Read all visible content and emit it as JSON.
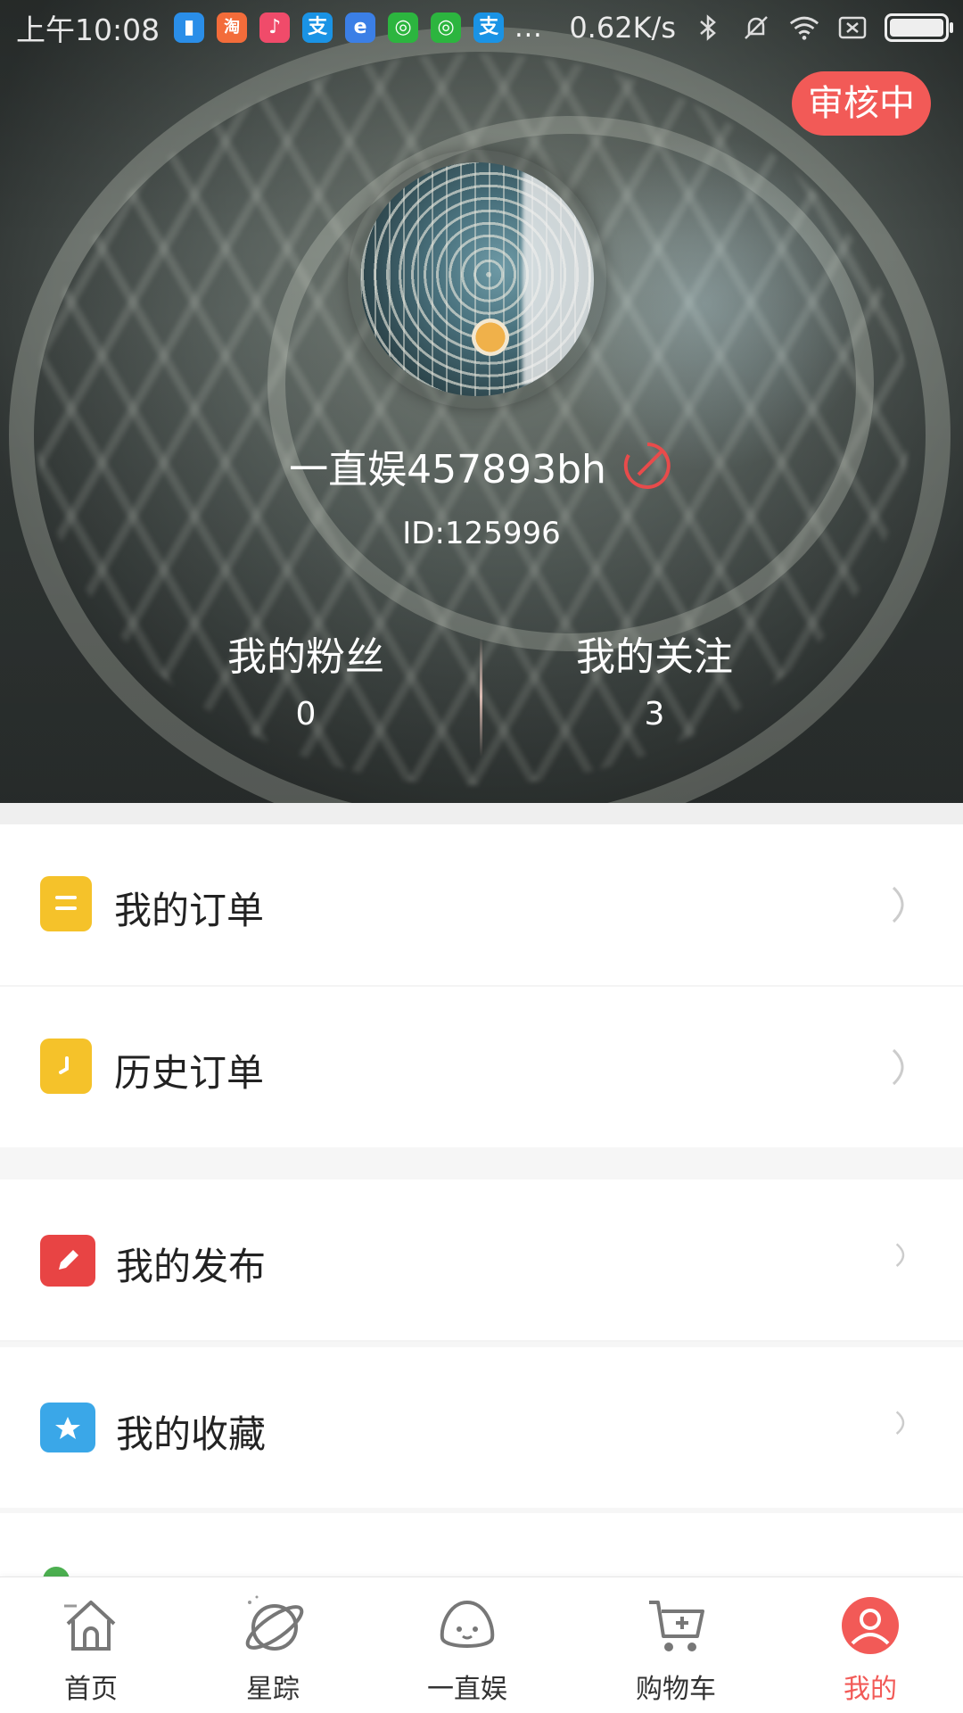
{
  "status_bar": {
    "time": "上午10:08",
    "apps": [
      {
        "icon": "notes-app-icon",
        "glyph": "▮",
        "color": "#2a8ee8"
      },
      {
        "icon": "taobao-app-icon",
        "glyph": "淘",
        "color": "#f36c3a"
      },
      {
        "icon": "douyin-app-icon",
        "glyph": "♪",
        "color": "#f04b6a"
      },
      {
        "icon": "alipay-app-icon",
        "glyph": "支",
        "color": "#1a93e5"
      },
      {
        "icon": "browser-app-icon",
        "glyph": "e",
        "color": "#3b7fe6"
      },
      {
        "icon": "wechat-app-icon",
        "glyph": "◎",
        "color": "#2cb53f"
      },
      {
        "icon": "wechat-app-icon-2",
        "glyph": "◎",
        "color": "#2cb53f"
      },
      {
        "icon": "alipay-app-icon-2",
        "glyph": "支",
        "color": "#1a93e5"
      }
    ],
    "more": "...",
    "net_speed": "0.62K/s"
  },
  "review_badge": "审核中",
  "profile": {
    "username": "一直娱457893bh",
    "user_id": "ID:125996"
  },
  "stats": {
    "fans_label": "我的粉丝",
    "fans_value": "0",
    "follow_label": "我的关注",
    "follow_value": "3"
  },
  "menu": {
    "items": [
      {
        "label": "我的订单",
        "icon": "order-icon",
        "color": "#f5c22a"
      },
      {
        "label": "历史订单",
        "icon": "history-icon",
        "color": "#f5c22a"
      },
      {
        "label": "我的发布",
        "icon": "pencil-icon",
        "color": "#e84444"
      },
      {
        "label": "我的收藏",
        "icon": "star-folder-icon",
        "color": "#3aa7e8"
      }
    ]
  },
  "bottom_nav": {
    "items": [
      {
        "label": "首页",
        "icon": "home-icon"
      },
      {
        "label": "星踪",
        "icon": "planet-icon"
      },
      {
        "label": "一直娱",
        "icon": "mascot-icon"
      },
      {
        "label": "购物车",
        "icon": "cart-icon"
      },
      {
        "label": "我的",
        "icon": "profile-icon"
      }
    ],
    "active_index": 4,
    "active_color": "#f25a57"
  }
}
